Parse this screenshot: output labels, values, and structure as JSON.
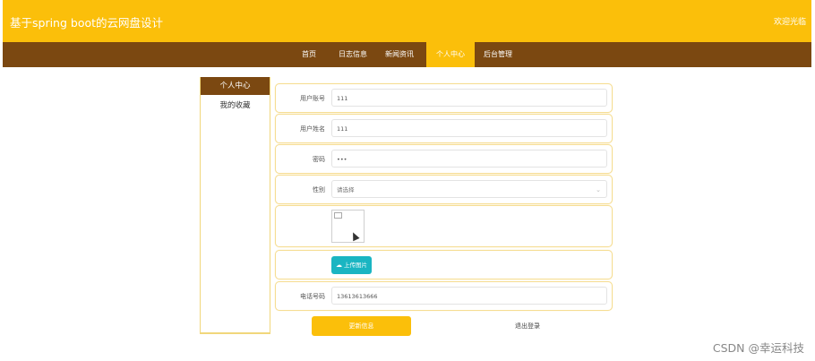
{
  "header": {
    "title": "基于spring boot的云网盘设计",
    "welcome": "欢迎光临"
  },
  "nav": {
    "items": [
      "首页",
      "日志信息",
      "新闻资讯",
      "个人中心",
      "后台管理"
    ],
    "active_index": 3
  },
  "sidebar": {
    "items": [
      "个人中心",
      "我的收藏"
    ],
    "active_index": 0
  },
  "form": {
    "account": {
      "label": "用户账号",
      "value": "111"
    },
    "name": {
      "label": "用户姓名",
      "value": "111"
    },
    "password": {
      "label": "密码",
      "value": "•••"
    },
    "gender": {
      "label": "性别",
      "placeholder": "请选择"
    },
    "upload": {
      "label": "上传图片"
    },
    "phone": {
      "label": "电话号码",
      "value": "13613613666"
    }
  },
  "actions": {
    "update": "更新信息",
    "logout": "退出登录"
  },
  "watermark": "CSDN @幸运科技",
  "colors": {
    "primary": "#fbbf0a",
    "nav": "#7b4811",
    "upload": "#1ab5c2"
  }
}
